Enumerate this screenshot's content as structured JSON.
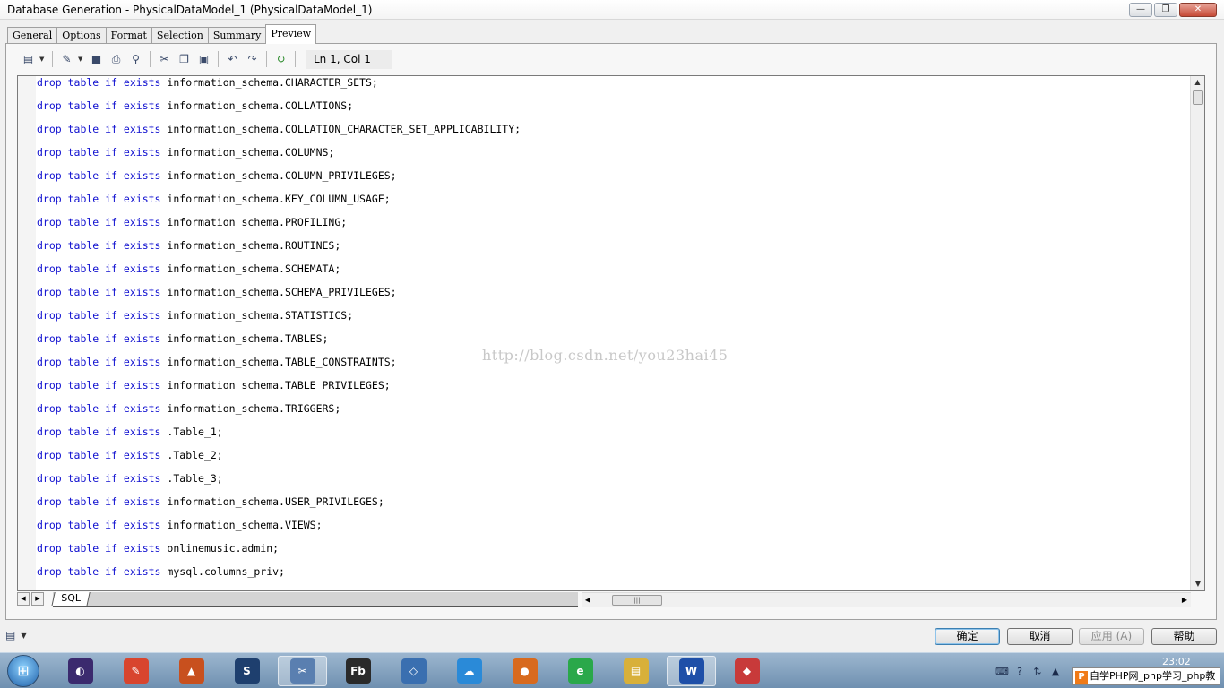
{
  "window": {
    "title": "Database Generation - PhysicalDataModel_1 (PhysicalDataModel_1)",
    "minimize": "—",
    "maximize": "❐",
    "close": "✕"
  },
  "tabs": [
    {
      "label": "General",
      "active": false
    },
    {
      "label": "Options",
      "active": false
    },
    {
      "label": "Format",
      "active": false
    },
    {
      "label": "Selection",
      "active": false
    },
    {
      "label": "Summary",
      "active": false
    },
    {
      "label": "Preview",
      "active": true
    }
  ],
  "toolbar": {
    "cursor_position": "Ln 1, Col 1"
  },
  "editor": {
    "statement_prefix": "drop table if exists",
    "lines": [
      "information_schema.CHARACTER_SETS;",
      "information_schema.COLLATIONS;",
      "information_schema.COLLATION_CHARACTER_SET_APPLICABILITY;",
      "information_schema.COLUMNS;",
      "information_schema.COLUMN_PRIVILEGES;",
      "information_schema.KEY_COLUMN_USAGE;",
      "information_schema.PROFILING;",
      "information_schema.ROUTINES;",
      "information_schema.SCHEMATA;",
      "information_schema.SCHEMA_PRIVILEGES;",
      "information_schema.STATISTICS;",
      "information_schema.TABLES;",
      "information_schema.TABLE_CONSTRAINTS;",
      "information_schema.TABLE_PRIVILEGES;",
      "information_schema.TRIGGERS;",
      ".Table_1;",
      ".Table_2;",
      ".Table_3;",
      "information_schema.USER_PRIVILEGES;",
      "information_schema.VIEWS;",
      "onlinemusic.admin;",
      "mysql.columns_priv;"
    ],
    "watermark": "http://blog.csdn.net/you23hai45"
  },
  "sheet_tab": "SQL",
  "buttons": {
    "ok": "确定",
    "cancel": "取消",
    "apply": "应用 (A)",
    "help": "帮助"
  },
  "taskbar": {
    "items": [
      {
        "name": "eclipse",
        "color": "#3b2a6e",
        "glyph": "◐"
      },
      {
        "name": "notepad",
        "color": "#d8452e",
        "glyph": "✎"
      },
      {
        "name": "matlab",
        "color": "#c8501e",
        "glyph": "▲"
      },
      {
        "name": "sql-tool",
        "color": "#1e3f6e",
        "glyph": "S"
      },
      {
        "name": "powerdesigner",
        "color": "#5a7fb0",
        "glyph": "✂"
      },
      {
        "name": "flash-builder",
        "color": "#2a2a2a",
        "glyph": "Fb"
      },
      {
        "name": "virtualbox",
        "color": "#3a6fb0",
        "glyph": "◇"
      },
      {
        "name": "cloud-app",
        "color": "#2a8ad8",
        "glyph": "☁"
      },
      {
        "name": "firefox",
        "color": "#d86a1e",
        "glyph": "●"
      },
      {
        "name": "ie-browser",
        "color": "#2aa84a",
        "glyph": "e"
      },
      {
        "name": "explorer",
        "color": "#d8b03a",
        "glyph": "▤"
      },
      {
        "name": "word",
        "color": "#1e4fa8",
        "glyph": "W"
      },
      {
        "name": "paint-app",
        "color": "#c83a3a",
        "glyph": "◆"
      }
    ],
    "clock": "23:02",
    "notification": "自学PHP网_php学习_php教"
  },
  "colors": {
    "keyword": "#1010d0",
    "watermark": "#c8c8c8"
  }
}
